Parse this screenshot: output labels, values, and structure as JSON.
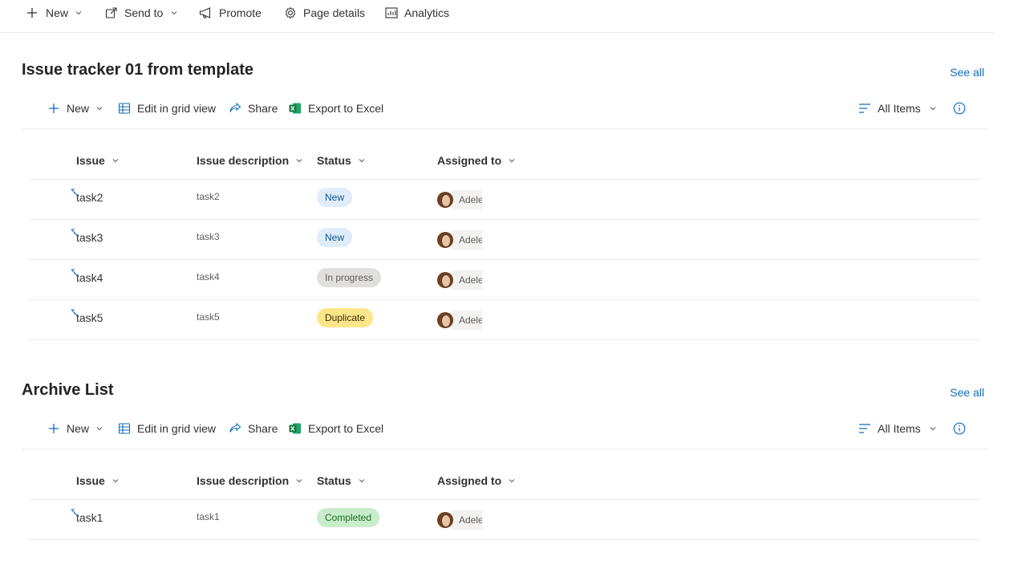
{
  "topbar": {
    "new_label": "New",
    "send_label": "Send to",
    "promote_label": "Promote",
    "page_details_label": "Page details",
    "analytics_label": "Analytics"
  },
  "sections": [
    {
      "title": "Issue tracker 01 from template",
      "see_all": "See all",
      "toolbar": {
        "new": "New",
        "grid": "Edit in grid view",
        "share": "Share",
        "export": "Export to Excel",
        "view": "All Items"
      },
      "columns": [
        "Issue",
        "Issue description",
        "Status",
        "Assigned to"
      ],
      "rows": [
        {
          "issue": "task2",
          "desc": "task2",
          "status": "New",
          "person": "Adele"
        },
        {
          "issue": "task3",
          "desc": "task3",
          "status": "New",
          "person": "Adele"
        },
        {
          "issue": "task4",
          "desc": "task4",
          "status": "In progress",
          "person": "Adele"
        },
        {
          "issue": "task5",
          "desc": "task5",
          "status": "Duplicate",
          "person": "Adele"
        }
      ]
    },
    {
      "title": "Archive List",
      "see_all": "See all",
      "toolbar": {
        "new": "New",
        "grid": "Edit in grid view",
        "share": "Share",
        "export": "Export to Excel",
        "view": "All Items"
      },
      "columns": [
        "Issue",
        "Issue description",
        "Status",
        "Assigned to"
      ],
      "rows": [
        {
          "issue": "task1",
          "desc": "task1",
          "status": "Completed",
          "person": "Adele"
        }
      ]
    }
  ],
  "colors": {
    "accent": "#0f6cbd",
    "status_new": "#dfecfa",
    "status_in_progress": "#e1dfdd",
    "status_duplicate": "#fde68a",
    "status_completed": "#c9eccb",
    "excel_green": "#107c41"
  }
}
